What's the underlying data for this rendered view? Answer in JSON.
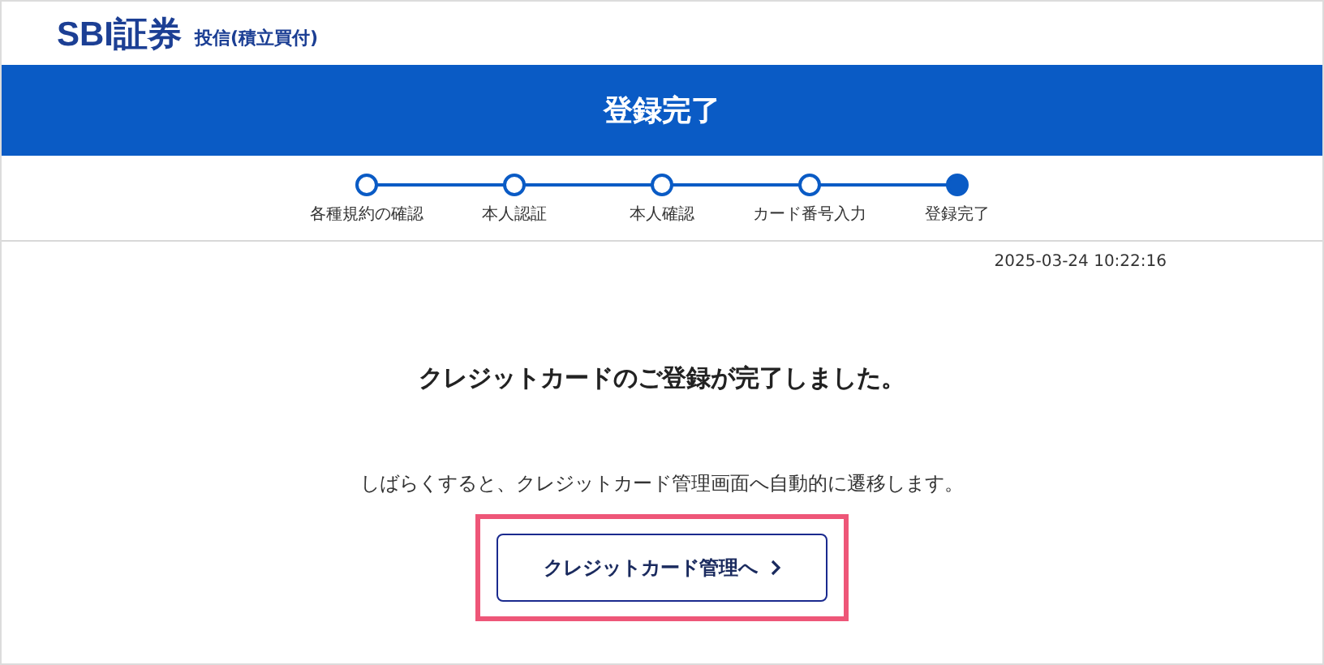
{
  "header": {
    "logo": "SBI証券",
    "subtitle": "投信(積立買付)"
  },
  "banner": {
    "title": "登録完了"
  },
  "steps": [
    {
      "label": "各種規約の確認",
      "selected": false
    },
    {
      "label": "本人認証",
      "selected": false
    },
    {
      "label": "本人確認",
      "selected": false
    },
    {
      "label": "カード番号入力",
      "selected": false
    },
    {
      "label": "登録完了",
      "selected": true
    }
  ],
  "timestamp": "2025-03-24 10:22:16",
  "message": "クレジットカードのご登録が完了しました。",
  "note": "しばらくすると、クレジットカード管理画面へ自動的に遷移します。",
  "button": {
    "label": "クレジットカード管理へ",
    "highlighted": true
  }
}
